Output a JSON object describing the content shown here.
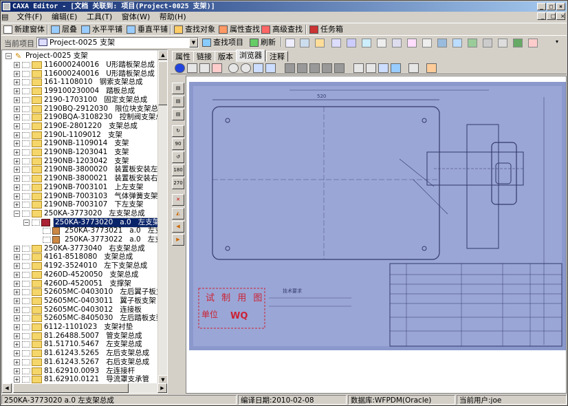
{
  "window": {
    "title": "CAXA Editor - [文档 关联到: 项目(Project-0025      支架)]"
  },
  "menu": [
    "文件(F)",
    "编辑(E)",
    "工具(T)",
    "窗体(W)",
    "帮助(H)"
  ],
  "toolbar": {
    "new_window": "新建窗体",
    "cascade": "层叠",
    "tile_h": "水平平铺",
    "tile_v": "垂直平铺",
    "find_object": "查找对象",
    "attr_search": "属性查找",
    "advanced_search": "高级查找",
    "task_box": "任务箱"
  },
  "project_bar": {
    "label": "当前项目",
    "value": "Project-0025      支架",
    "find_project": "查找项目",
    "refresh": "刷新"
  },
  "tree": {
    "root": "Project-0025      支架",
    "items": [
      [
        "116000240016",
        "U形踏板架总成"
      ],
      [
        "116000240016",
        "U形踏板架总成"
      ],
      [
        "161-1108010",
        "钢索支架总成"
      ],
      [
        "199100230004",
        "踏板总成"
      ],
      [
        "2190-1703100",
        "固定支架总成"
      ],
      [
        "2190BQ-2912030",
        "限位块支架总成"
      ],
      [
        "2190BQA-3108230",
        "控制阀支架总成"
      ],
      [
        "2190E-2801220",
        "支架总成"
      ],
      [
        "2190L-1109012",
        "支架"
      ],
      [
        "2190NB-1109014",
        "支架"
      ],
      [
        "2190NB-1203041",
        "支架"
      ],
      [
        "2190NB-1203042",
        "支架"
      ],
      [
        "2190NB-3800020",
        "装置板安装左支架"
      ],
      [
        "2190NB-3800021",
        "装置板安装右支架"
      ],
      [
        "2190NB-7003101",
        "上左支架"
      ],
      [
        "2190NB-7003103",
        "气体弹簧支架"
      ],
      [
        "2190NB-7003107",
        "下左支架"
      ],
      [
        "250KA-3773020",
        "左支架总成"
      ]
    ],
    "selected": [
      "250KA-3773020",
      "a.0",
      "左支架总成"
    ],
    "children": [
      [
        "250KA-3773021",
        "a.0",
        "左支架"
      ],
      [
        "250KA-3773022",
        "a.0",
        "左支架板"
      ]
    ],
    "items_after": [
      [
        "250KA-3773040",
        "右支架总成"
      ],
      [
        "4161-8518080",
        "支架总成"
      ],
      [
        "4192-3524010",
        "左下支架总成"
      ],
      [
        "4260D-4520050",
        "支架总成"
      ],
      [
        "4260D-4520051",
        "支撑架"
      ],
      [
        "52605MC-0403010",
        "左后翼子板支架总"
      ],
      [
        "52605MC-0403011",
        "翼子板支架"
      ],
      [
        "52605MC-0403012",
        "连接板"
      ],
      [
        "52605MC-8405030",
        "左后踏板支架总成"
      ],
      [
        "6112-1101023",
        "支架衬垫"
      ],
      [
        "81.26488.5007",
        "管支架总成"
      ],
      [
        "81.51710.5467",
        "左支架总成"
      ],
      [
        "81.61243.5265",
        "左后支架总成"
      ],
      [
        "81.61243.5267",
        "右后支架总成"
      ],
      [
        "81.62910.0093",
        "左连接杆"
      ],
      [
        "81.62910.0121",
        "导流罩支承管"
      ]
    ]
  },
  "tabs": [
    "属性",
    "链接",
    "版本",
    "浏览器",
    "注释"
  ],
  "active_tab": "浏览器",
  "drawing": {
    "stamp_top": "试 制 用 图",
    "stamp_bottom": "单位",
    "stamp_code": "WQ",
    "notes_title": "技术要求",
    "dim_top": "520"
  },
  "status": {
    "item": "250KA-3773020  a.0  左支架总成",
    "date": "编译日期:2010-02-08",
    "db": "数据库:WFPDM(Oracle)",
    "user": "当前用户:joe"
  }
}
